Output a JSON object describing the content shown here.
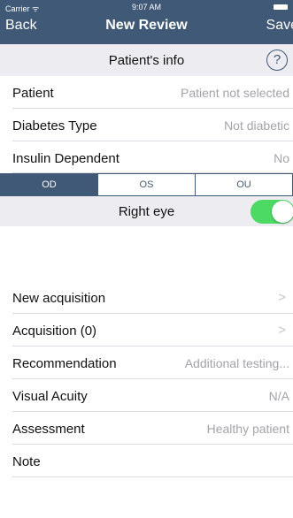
{
  "status_bar": {
    "carrier": "Carrier ᯤ",
    "time": "9:07 AM"
  },
  "nav": {
    "back_label": "Back",
    "title": "New Review",
    "save_label": "Save"
  },
  "patient_info": {
    "title": "Patient's info",
    "help_label": "?"
  },
  "rows_top": [
    {
      "label": "Patient",
      "value": "Patient not selected"
    },
    {
      "label": "Diabetes Type",
      "value": "Not diabetic"
    },
    {
      "label": "Insulin Dependent",
      "value": "No"
    }
  ],
  "eye_segments": {
    "selected": "OD",
    "options": [
      "OD",
      "OS",
      "OU"
    ]
  },
  "eye_toggle": {
    "label": "Right eye",
    "on": true
  },
  "rows_bottom": [
    {
      "label": "New acquisition",
      "value": "",
      "chevron": true
    },
    {
      "label": "Acquisition (0)",
      "value": "",
      "chevron": true
    },
    {
      "label": "Recommendation",
      "value": "Additional testing..."
    },
    {
      "label": "Visual Acuity",
      "value": "N/A"
    },
    {
      "label": "Assessment",
      "value": "Healthy patient"
    },
    {
      "label": "Note",
      "value": ""
    }
  ],
  "icons": {
    "chevron": "chevron-right-icon",
    "help": "question-circle-icon",
    "battery": "battery-icon"
  },
  "colors": {
    "nav": "#3f5976",
    "section": "#ececf1",
    "toggle_on": "#4cd964",
    "secondary_text": "#a3a3a8"
  }
}
